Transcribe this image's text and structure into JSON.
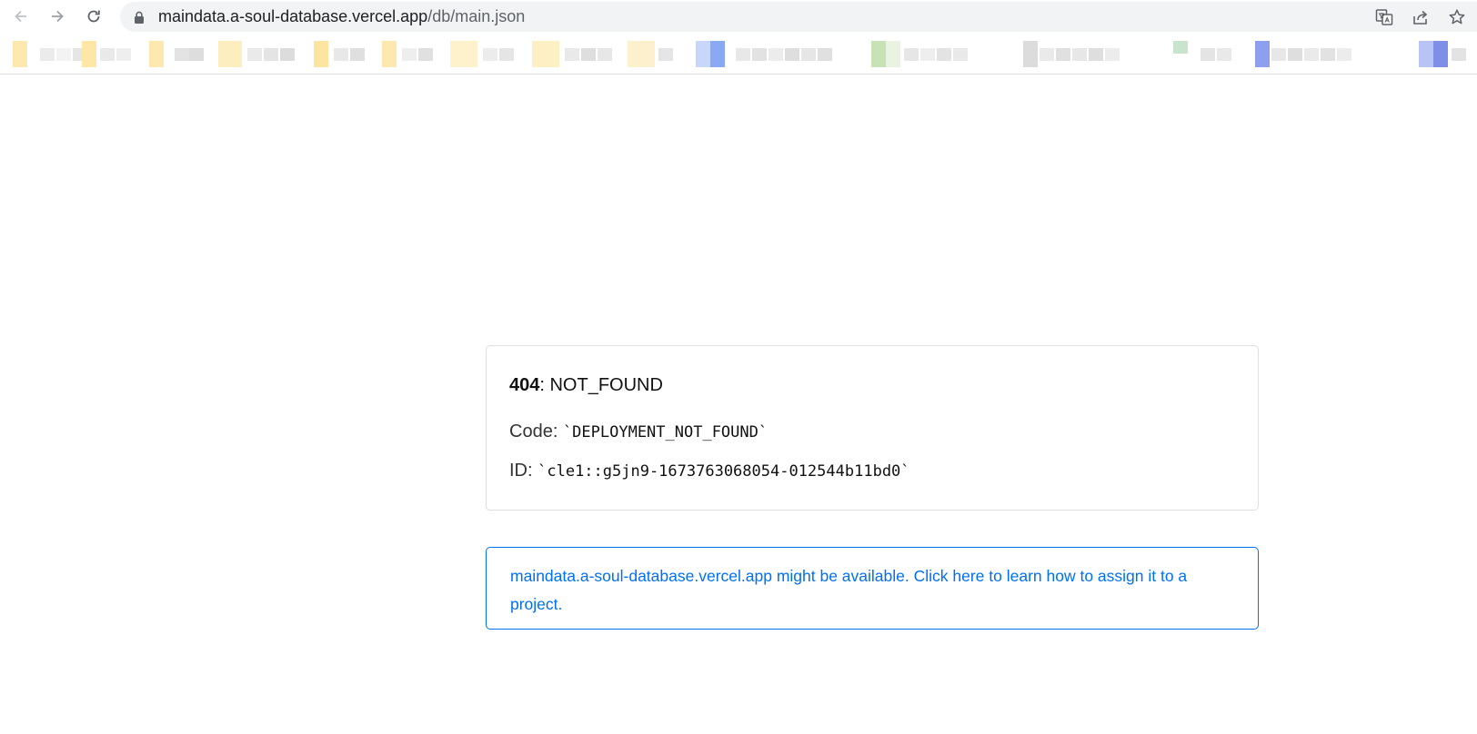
{
  "browser": {
    "url_host": "maindata.a-soul-database.vercel.app",
    "url_path": "/db/main.json",
    "icons": [
      "back-arrow-icon",
      "forward-arrow-icon",
      "reload-icon",
      "lock-icon",
      "translate-icon",
      "share-icon",
      "bookmark-star-icon"
    ]
  },
  "error": {
    "status": "404",
    "message": ": NOT_FOUND",
    "code_label": "Code: ",
    "code_value": "`DEPLOYMENT_NOT_FOUND`",
    "id_label": "ID: ",
    "id_value": "`cle1::g5jn9-1673763068054-012544b11bd0`"
  },
  "notice": {
    "text": "maindata.a-soul-database.vercel.app might be available. Click here to learn how to assign it to a project."
  },
  "colors": {
    "link": "#0070f3",
    "card_border": "#dfdfdf",
    "omnibox_bg": "#f1f3f4"
  }
}
